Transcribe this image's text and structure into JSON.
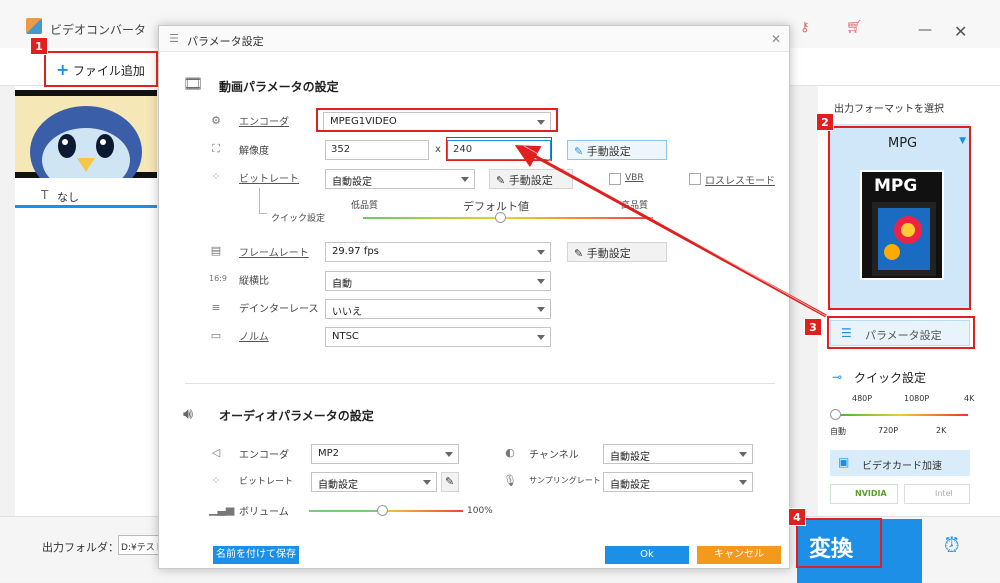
{
  "app": {
    "title": "ビデオコンバータ",
    "add_file": "ファイル追加",
    "file_item": "なし"
  },
  "bottom": {
    "output_folder_label": "出力フォルダ：",
    "output_folder_value": "D:¥テスト",
    "convert": "変換"
  },
  "right": {
    "select_format": "出力フォーマットを選択",
    "format": "MPG",
    "format_thumb": "MPG",
    "param_button": "パラメータ設定",
    "quick_setting": "クイック設定",
    "scale_top": [
      "480P",
      "1080P",
      "4K"
    ],
    "scale_bottom": [
      "自動",
      "720P",
      "2K"
    ],
    "gpu_accel": "ビデオカード加速",
    "nvidia": "NVIDIA",
    "intel": "Intel"
  },
  "dialog": {
    "title": "パラメータ設定",
    "video_section": "動画パラメータの設定",
    "encoder_label": "エンコーダ",
    "encoder_value": "MPEG1VIDEO",
    "resolution_label": "解像度",
    "width": "352",
    "x": "x",
    "height": "240",
    "manual1": "手動設定",
    "bitrate_label": "ビットレート",
    "bitrate_value": "自動設定",
    "manual2": "手動設定",
    "vbr": "VBR",
    "lossless": "ロスレスモード",
    "quick_label": "クイック設定",
    "low_q": "低品質",
    "default_v": "デフォルト値",
    "high_q": "高品質",
    "framerate_label": "フレームレート",
    "framerate_value": "29.97 fps",
    "manual3": "手動設定",
    "aspect_label": "縦横比",
    "aspect_value": "自動",
    "deinterlace_label": "デインターレース",
    "deinterlace_value": "いいえ",
    "norm_label": "ノルム",
    "norm_value": "NTSC",
    "audio_section": "オーディオパラメータの設定",
    "a_encoder_label": "エンコーダ",
    "a_encoder_value": "MP2",
    "channel_label": "チャンネル",
    "channel_value": "自動設定",
    "a_bitrate_label": "ビットレート",
    "a_bitrate_value": "自動設定",
    "sample_label": "サンプリングレート",
    "sample_value": "自動設定",
    "volume_label": "ボリューム",
    "volume_value": "100%",
    "save_as": "名前を付けて保存",
    "ok": "Ok",
    "cancel": "キャンセル"
  },
  "badges": [
    "1",
    "2",
    "3",
    "4"
  ],
  "colors": {
    "accent": "#1e8fe6",
    "highlight": "#e0201e",
    "cancel": "#f39a1e"
  }
}
